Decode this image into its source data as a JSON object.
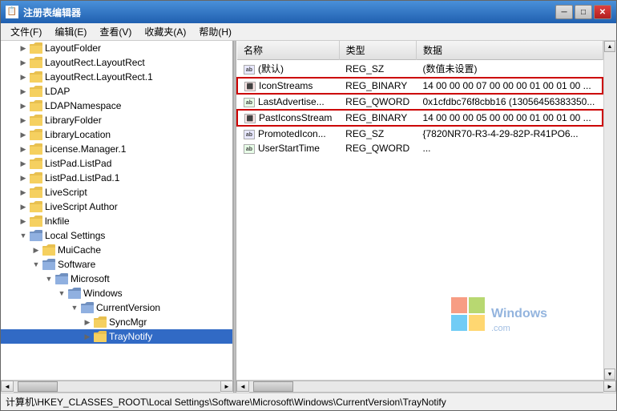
{
  "window": {
    "title": "注册表编辑器",
    "title_icon": "🗂"
  },
  "title_buttons": {
    "minimize": "─",
    "maximize": "□",
    "close": "✕"
  },
  "menu": {
    "items": [
      {
        "label": "文件(F)"
      },
      {
        "label": "编辑(E)"
      },
      {
        "label": "查看(V)"
      },
      {
        "label": "收藏夹(A)"
      },
      {
        "label": "帮助(H)"
      }
    ]
  },
  "tree": {
    "nodes": [
      {
        "label": "LayoutFolder",
        "indent": 1,
        "expanded": false
      },
      {
        "label": "LayoutRect.LayoutRect",
        "indent": 1,
        "expanded": false
      },
      {
        "label": "LayoutRect.LayoutRect.1",
        "indent": 1,
        "expanded": false
      },
      {
        "label": "LDAP",
        "indent": 1,
        "expanded": false
      },
      {
        "label": "LDAPNamespace",
        "indent": 1,
        "expanded": false
      },
      {
        "label": "LibraryFolder",
        "indent": 1,
        "expanded": false
      },
      {
        "label": "LibraryLocation",
        "indent": 1,
        "expanded": false
      },
      {
        "label": "License.Manager.1",
        "indent": 1,
        "expanded": false
      },
      {
        "label": "ListPad.ListPad",
        "indent": 1,
        "expanded": false
      },
      {
        "label": "ListPad.ListPad.1",
        "indent": 1,
        "expanded": false
      },
      {
        "label": "LiveScript",
        "indent": 1,
        "expanded": false
      },
      {
        "label": "LiveScript Author",
        "indent": 1,
        "expanded": false
      },
      {
        "label": "lnkfile",
        "indent": 1,
        "expanded": false
      },
      {
        "label": "Local Settings",
        "indent": 1,
        "expanded": true
      },
      {
        "label": "MuiCache",
        "indent": 2,
        "expanded": false
      },
      {
        "label": "Software",
        "indent": 2,
        "expanded": true
      },
      {
        "label": "Microsoft",
        "indent": 3,
        "expanded": true
      },
      {
        "label": "Windows",
        "indent": 4,
        "expanded": true
      },
      {
        "label": "CurrentVersion",
        "indent": 5,
        "expanded": true
      },
      {
        "label": "SyncMgr",
        "indent": 6,
        "expanded": false
      },
      {
        "label": "TrayNotify",
        "indent": 6,
        "expanded": false
      }
    ]
  },
  "registry_table": {
    "columns": [
      "名称",
      "类型",
      "数据"
    ],
    "rows": [
      {
        "name": "(默认)",
        "type": "REG_SZ",
        "data": "(数值未设置)",
        "icon_type": "ab",
        "highlighted": false
      },
      {
        "name": "IconStreams",
        "type": "REG_BINARY",
        "data": "14 00 00 00 07 00 00 00 01 00 01 00 ...",
        "icon_type": "bin",
        "highlighted": true
      },
      {
        "name": "LastAdvertise...",
        "type": "REG_QWORD",
        "data": "0x1cfdbc76f8cbb16 (13056456383350...",
        "icon_type": "qword",
        "highlighted": false
      },
      {
        "name": "PastIconsStream",
        "type": "REG_BINARY",
        "data": "14 00 00 00 05 00 00 00 01 00 01 00 ...",
        "icon_type": "bin",
        "highlighted": true
      },
      {
        "name": "PromotedIcon...",
        "type": "REG_SZ",
        "data": "{7820NR70-R3-4-29-82P-R41PO6...",
        "icon_type": "ab",
        "highlighted": false
      },
      {
        "name": "UserStartTime",
        "type": "REG_QWORD",
        "data": "...",
        "icon_type": "qword",
        "highlighted": false
      }
    ]
  },
  "status_bar": {
    "text": "计算机\\HKEY_CLASSES_ROOT\\Local Settings\\Software\\Microsoft\\Windows\\CurrentVersion\\TrayNotify"
  },
  "watermark": {
    "text": "Windows.com"
  }
}
